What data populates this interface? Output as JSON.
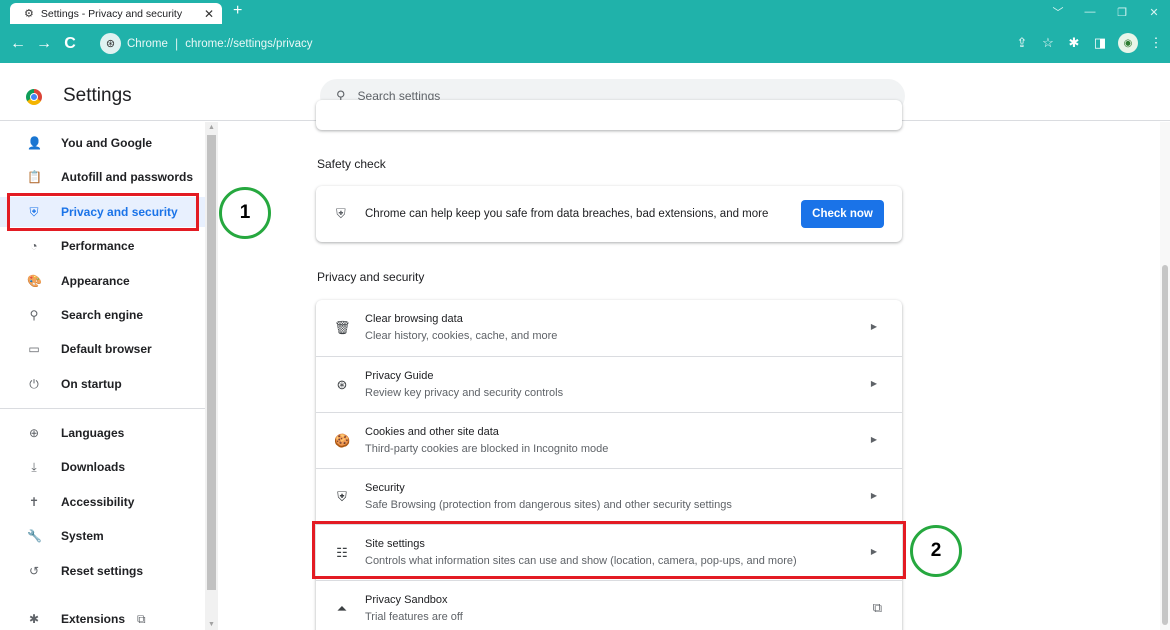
{
  "tab": {
    "title": "Settings - Privacy and security",
    "favicon": "⚙",
    "close": "✕",
    "new_tab": "+"
  },
  "window_controls": [
    "﹀",
    "—",
    "❐",
    "✕"
  ],
  "toolbar": {
    "back": "←",
    "forward": "→",
    "reload": "C"
  },
  "omnibox": {
    "site_name": "Chrome",
    "separator": "|",
    "url": "chrome://settings/privacy"
  },
  "toolbar_icons": [
    "⇪",
    "☆",
    "✱",
    "◨",
    "⋮"
  ],
  "header": {
    "title": "Settings",
    "search_placeholder": "Search settings"
  },
  "sidebar": {
    "items": [
      {
        "label": "You and Google",
        "icon": "person-icon",
        "glyph": "👤"
      },
      {
        "label": "Autofill and passwords",
        "icon": "clipboard-icon",
        "glyph": "📋"
      },
      {
        "label": "Privacy and security",
        "icon": "shield-icon",
        "glyph": "⛨"
      },
      {
        "label": "Performance",
        "icon": "speedometer-icon",
        "glyph": "◔"
      },
      {
        "label": "Appearance",
        "icon": "palette-icon",
        "glyph": "🎨"
      },
      {
        "label": "Search engine",
        "icon": "search-icon",
        "glyph": "⚲"
      },
      {
        "label": "Default browser",
        "icon": "browser-icon",
        "glyph": "▭"
      },
      {
        "label": "On startup",
        "icon": "power-icon",
        "glyph": "⏻"
      },
      {
        "label": "Languages",
        "icon": "globe-icon",
        "glyph": "⊕"
      },
      {
        "label": "Downloads",
        "icon": "download-icon",
        "glyph": "⤓"
      },
      {
        "label": "Accessibility",
        "icon": "accessibility-icon",
        "glyph": "✝"
      },
      {
        "label": "System",
        "icon": "wrench-icon",
        "glyph": "🔧"
      },
      {
        "label": "Reset settings",
        "icon": "reset-icon",
        "glyph": "↺"
      },
      {
        "label": "Extensions",
        "icon": "puzzle-icon",
        "glyph": "✱"
      }
    ],
    "extensions_link_glyph": "⧉"
  },
  "safety_check": {
    "title": "Safety check",
    "text": "Chrome can help keep you safe from data breaches, bad extensions, and more",
    "button": "Check now"
  },
  "privacy": {
    "title": "Privacy and security",
    "rows": [
      {
        "title": "Clear browsing data",
        "subtitle": "Clear history, cookies, cache, and more",
        "icon": "trash-icon",
        "glyph": "🗑",
        "action": "▶"
      },
      {
        "title": "Privacy Guide",
        "subtitle": "Review key privacy and security controls",
        "icon": "compass-icon",
        "glyph": "⊛",
        "action": "▶"
      },
      {
        "title": "Cookies and other site data",
        "subtitle": "Third-party cookies are blocked in Incognito mode",
        "icon": "cookie-icon",
        "glyph": "🍪",
        "action": "▶"
      },
      {
        "title": "Security",
        "subtitle": "Safe Browsing (protection from dangerous sites) and other security settings",
        "icon": "security-shield-icon",
        "glyph": "⛨",
        "action": "▶"
      },
      {
        "title": "Site settings",
        "subtitle": "Controls what information sites can use and show (location, camera, pop-ups, and more)",
        "icon": "sliders-icon",
        "glyph": "☷",
        "action": "▶"
      },
      {
        "title": "Privacy Sandbox",
        "subtitle": "Trial features are off",
        "icon": "flask-icon",
        "glyph": "⏶",
        "action": "⧉"
      }
    ]
  },
  "annotations": {
    "step1": "1",
    "step2": "2"
  },
  "colors": {
    "accent": "#1a73e8",
    "frame": "#20b2aa",
    "highlight_box": "#e31b23",
    "step_circle": "#26a83f"
  }
}
